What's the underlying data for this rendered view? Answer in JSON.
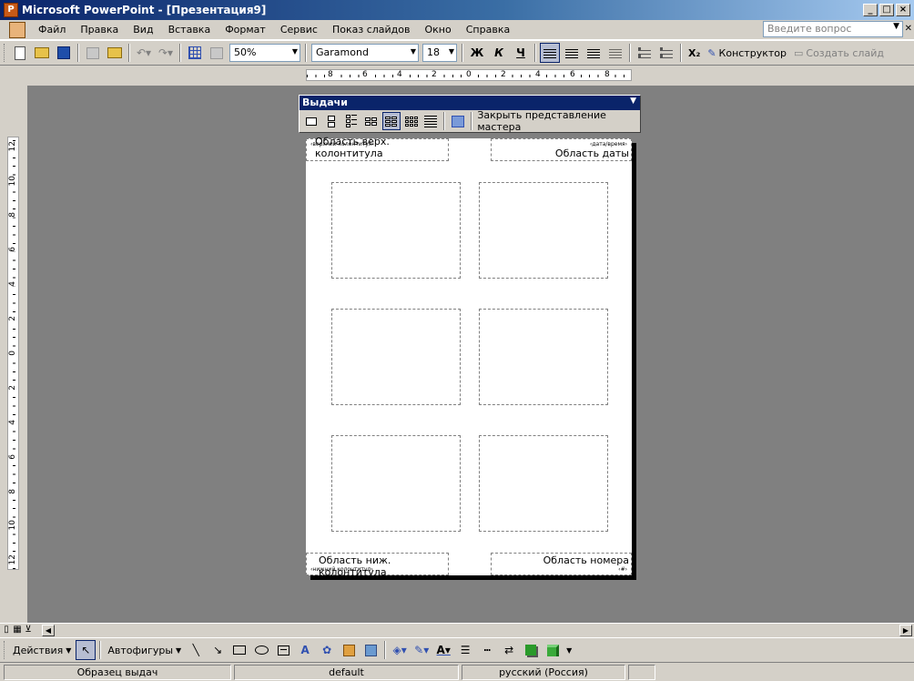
{
  "window": {
    "title": "Microsoft PowerPoint - [Презентация9]",
    "buttons": [
      "_",
      "□",
      "×"
    ]
  },
  "menu": {
    "items": [
      "Файл",
      "Правка",
      "Вид",
      "Вставка",
      "Формат",
      "Сервис",
      "Показ слайдов",
      "Окно",
      "Справка"
    ],
    "ask_placeholder": "Введите вопрос"
  },
  "toolbar": {
    "zoom": "50%",
    "font": "Garamond",
    "size": "18",
    "bold": "Ж",
    "italic": "К",
    "underline": "Ч",
    "subscript": "X₂",
    "designer": "Конструктор",
    "new_slide": "Создать слайд"
  },
  "hruler": [
    "8",
    "6",
    "4",
    "2",
    "0",
    "2",
    "4",
    "6",
    "8"
  ],
  "vruler": [
    "12",
    "10",
    "8",
    "6",
    "4",
    "2",
    "0",
    "2",
    "4",
    "6",
    "8",
    "10",
    "12"
  ],
  "handout_toolbar": {
    "title": "Выдачи",
    "close_master": "Закрыть представление мастера"
  },
  "page": {
    "header_tiny": "‹верхний колонтитул›",
    "header_label": "Область верх. колонтитула",
    "date_tiny": "‹дата/время›",
    "date_label": "Область даты",
    "footer_label": "Область ниж. колонтитула",
    "footer_tiny": "‹нижний колонтитул›",
    "number_label": "Область номера",
    "number_tiny": "‹#›"
  },
  "drawing": {
    "actions": "Действия",
    "autoshapes": "Автофигуры"
  },
  "status": {
    "view": "Образец выдач",
    "template": "default",
    "language": "русский (Россия)"
  }
}
